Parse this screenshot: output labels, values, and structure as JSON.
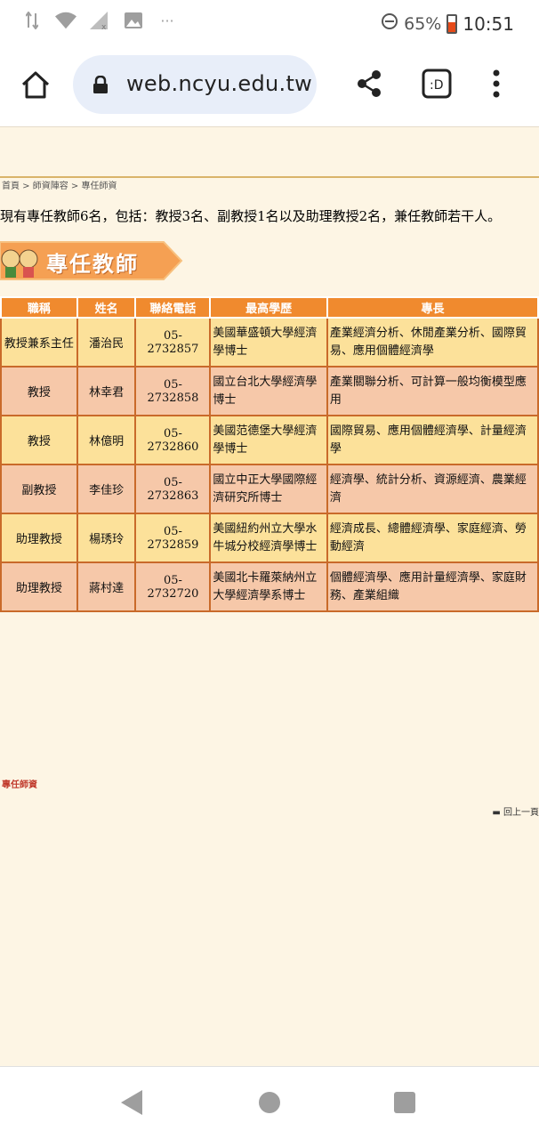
{
  "status": {
    "battery": "65%",
    "time": "10:51"
  },
  "browser": {
    "url": "web.ncyu.edu.tw"
  },
  "breadcrumb": "首頁 > 師資陣容 > 專任師資",
  "intro": "現有專任教師6名，包括：教授3名、副教授1名以及助理教授2名，兼任教師若干人。",
  "banner_title": "專任教師",
  "table": {
    "headers": [
      "職稱",
      "姓名",
      "聯絡電話",
      "最高學歷",
      "專長"
    ],
    "rows": [
      {
        "title": "教授兼系主任",
        "name": "潘治民",
        "phone": "05-2732857",
        "edu": "美國華盛頓大學經濟學博士",
        "spec": "產業經濟分析、休閒產業分析、國際貿易、應用個體經濟學"
      },
      {
        "title": "教授",
        "name": "林幸君",
        "phone": "05-2732858",
        "edu": "國立台北大學經濟學博士",
        "spec": "產業關聯分析、可計算一般均衡模型應用"
      },
      {
        "title": "教授",
        "name": "林億明",
        "phone": "05-2732860",
        "edu": "美國范德堡大學經濟學博士",
        "spec": "國際貿易、應用個體經濟學、計量經濟學"
      },
      {
        "title": "副教授",
        "name": "李佳珍",
        "phone": "05-2732863",
        "edu": "國立中正大學國際經濟研究所博士",
        "spec": "經濟學、統計分析、資源經濟、農業經濟"
      },
      {
        "title": "助理教授",
        "name": "楊琇玲",
        "phone": "05-2732859",
        "edu": "美國紐約州立大學水牛城分校經濟學博士",
        "spec": "經濟成長、總體經濟學、家庭經濟、勞動經濟"
      },
      {
        "title": "助理教授",
        "name": "蔣村達",
        "phone": "05-2732720",
        "edu": "美國北卡羅萊納州立大學經濟學系博士",
        "spec": "個體經濟學、應用計量經濟學、家庭財務、產業組織"
      }
    ]
  },
  "footer_link": "專任師資",
  "back_to_top": "回上一頁",
  "colors": {
    "header": "#f08a2e",
    "row_odd": "#fce19a",
    "row_even": "#f6c8a9",
    "page_bg": "#fdf5e4"
  }
}
